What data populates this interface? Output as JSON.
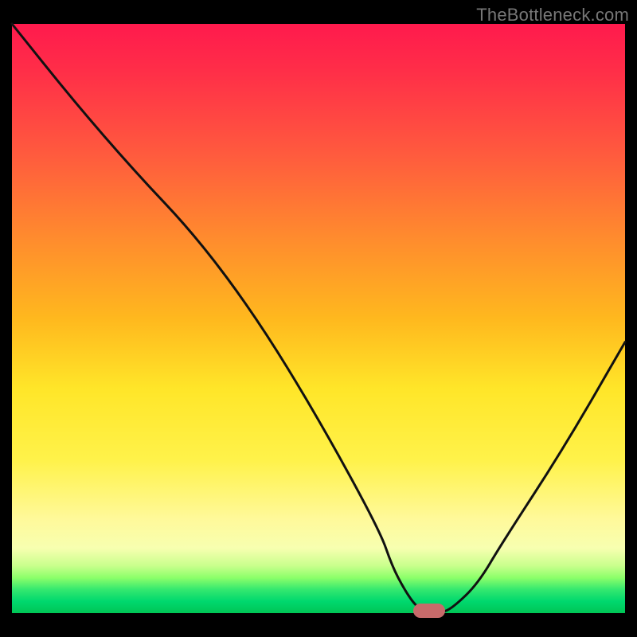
{
  "watermark": "TheBottleneck.com",
  "colors": {
    "frame_bg": "#000000",
    "curve": "#111111",
    "marker": "#c76a6a",
    "watermark_text": "#777777"
  },
  "chart_data": {
    "type": "line",
    "title": "",
    "xlabel": "",
    "ylabel": "",
    "xlim": [
      0,
      100
    ],
    "ylim": [
      0,
      100
    ],
    "x": [
      0,
      10,
      20,
      30,
      40,
      50,
      60,
      62,
      64,
      66,
      68,
      70,
      72,
      76,
      80,
      90,
      100
    ],
    "values": [
      100,
      87,
      75,
      64,
      50,
      33,
      14,
      8,
      4,
      1,
      0,
      0,
      1,
      5,
      12,
      28,
      46
    ],
    "gradient_stops": [
      {
        "pos": 0,
        "color": "#ff1a4d"
      },
      {
        "pos": 22,
        "color": "#ff5a3e"
      },
      {
        "pos": 50,
        "color": "#ffb81e"
      },
      {
        "pos": 74,
        "color": "#fff24a"
      },
      {
        "pos": 92,
        "color": "#c8ff8c"
      },
      {
        "pos": 100,
        "color": "#00c555"
      }
    ],
    "marker": {
      "x": 68,
      "y": 0,
      "color": "#c76a6a"
    }
  }
}
